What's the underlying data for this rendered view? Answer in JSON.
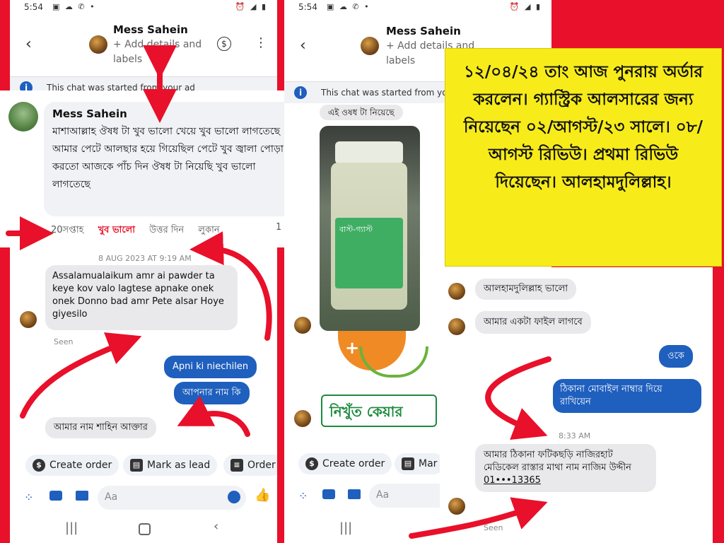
{
  "left_phone": {
    "status_time": "5:54",
    "contact_name": "Mess Sahein",
    "header_sub": "+ Add details and labels",
    "banner": "This chat was started from your ad",
    "comment": {
      "author": "Mess Sahein",
      "text": "মাশাআল্লাহ ঔষধ টা খুব ভালো খেয়ে খুব ভালো লাগতেছে আমার পেটে আলছার হয়ে গিয়েছিল পেটে খুব জ্বালা পোড়া করতো আজকে পাঁচ দিন ঔষধ টা নিয়েছি খুব ভালো লাগতেছে",
      "age": "20সপ্তাহ",
      "reaction": "খুব ভালো",
      "reply": "উত্তর দিন",
      "hide": "লুকান",
      "likes": "1"
    },
    "timestamp": "8 AUG 2023 AT 9:19 AM",
    "incoming_1": "Assalamualaikum amr  ai pawder ta keye kov valo lagtese apnake onek onek Donno bad amr Pete alsar Hoye giyesilo",
    "seen": "Seen",
    "outgoing_1": "Apni ki niechilen",
    "outgoing_2": "আপনার নাম কি",
    "incoming_2": "আমার নাম শাহিন আক্তার",
    "quick_create": "Create order",
    "quick_lead": "Mark as lead",
    "quick_order": "Order",
    "compose_placeholder": "Aa"
  },
  "right_phone": {
    "status_time": "5:54",
    "contact_name": "Mess Sahein",
    "header_sub": "+ Add details and labels",
    "banner": "This chat was started from your ad",
    "caption": "এই ওষধ টা নিয়েছে",
    "jar_label": "বাস্ট-গ্যাস্ট",
    "brand": "নিখুঁত কেয়ার",
    "msg_1": "আলহামদুলিল্লাহ ভালো",
    "msg_2": "আমার একটা ফাইল লাগবে",
    "out_1": "ওকে",
    "out_2": "ঠিকানা মোবাইল নাম্বার দিয়ে রাখিয়েন",
    "time": "8:33 AM",
    "msg_3": "আমার ঠিকানা ফটিকছড়ি নাজিরহাট মেডিকেল রাস্তার মাথা নাম নাজিম উদ্দীন",
    "msg_3_phone": "01•••13365",
    "seen": "Seen",
    "quick_create": "Create order",
    "quick_lead": "Mar",
    "compose_placeholder": "Aa"
  },
  "yellow_note": "১২/০৪/২৪ তাং আজ পুনরায় অর্ডার করলেন। গ্যাস্ট্রিক আলসারের জন্য নিয়েছেন ০২/আগস্ট/২৩ সালে। ০৮/আগস্ট রিভিউ। প্রথমা রিভিউ দিয়েছেন। আলহামদুলিল্লাহ।",
  "colors": {
    "background": "#e8102a",
    "outgoing": "#1f5fbe",
    "note": "#f7ec1a",
    "arrow": "#e8102a"
  },
  "icons": [
    "back-arrow-icon",
    "dollar-icon",
    "more-icon",
    "info-icon",
    "camera-icon",
    "gallery-icon",
    "emoji-icon",
    "thumbs-up-icon",
    "menu-grid-icon"
  ]
}
